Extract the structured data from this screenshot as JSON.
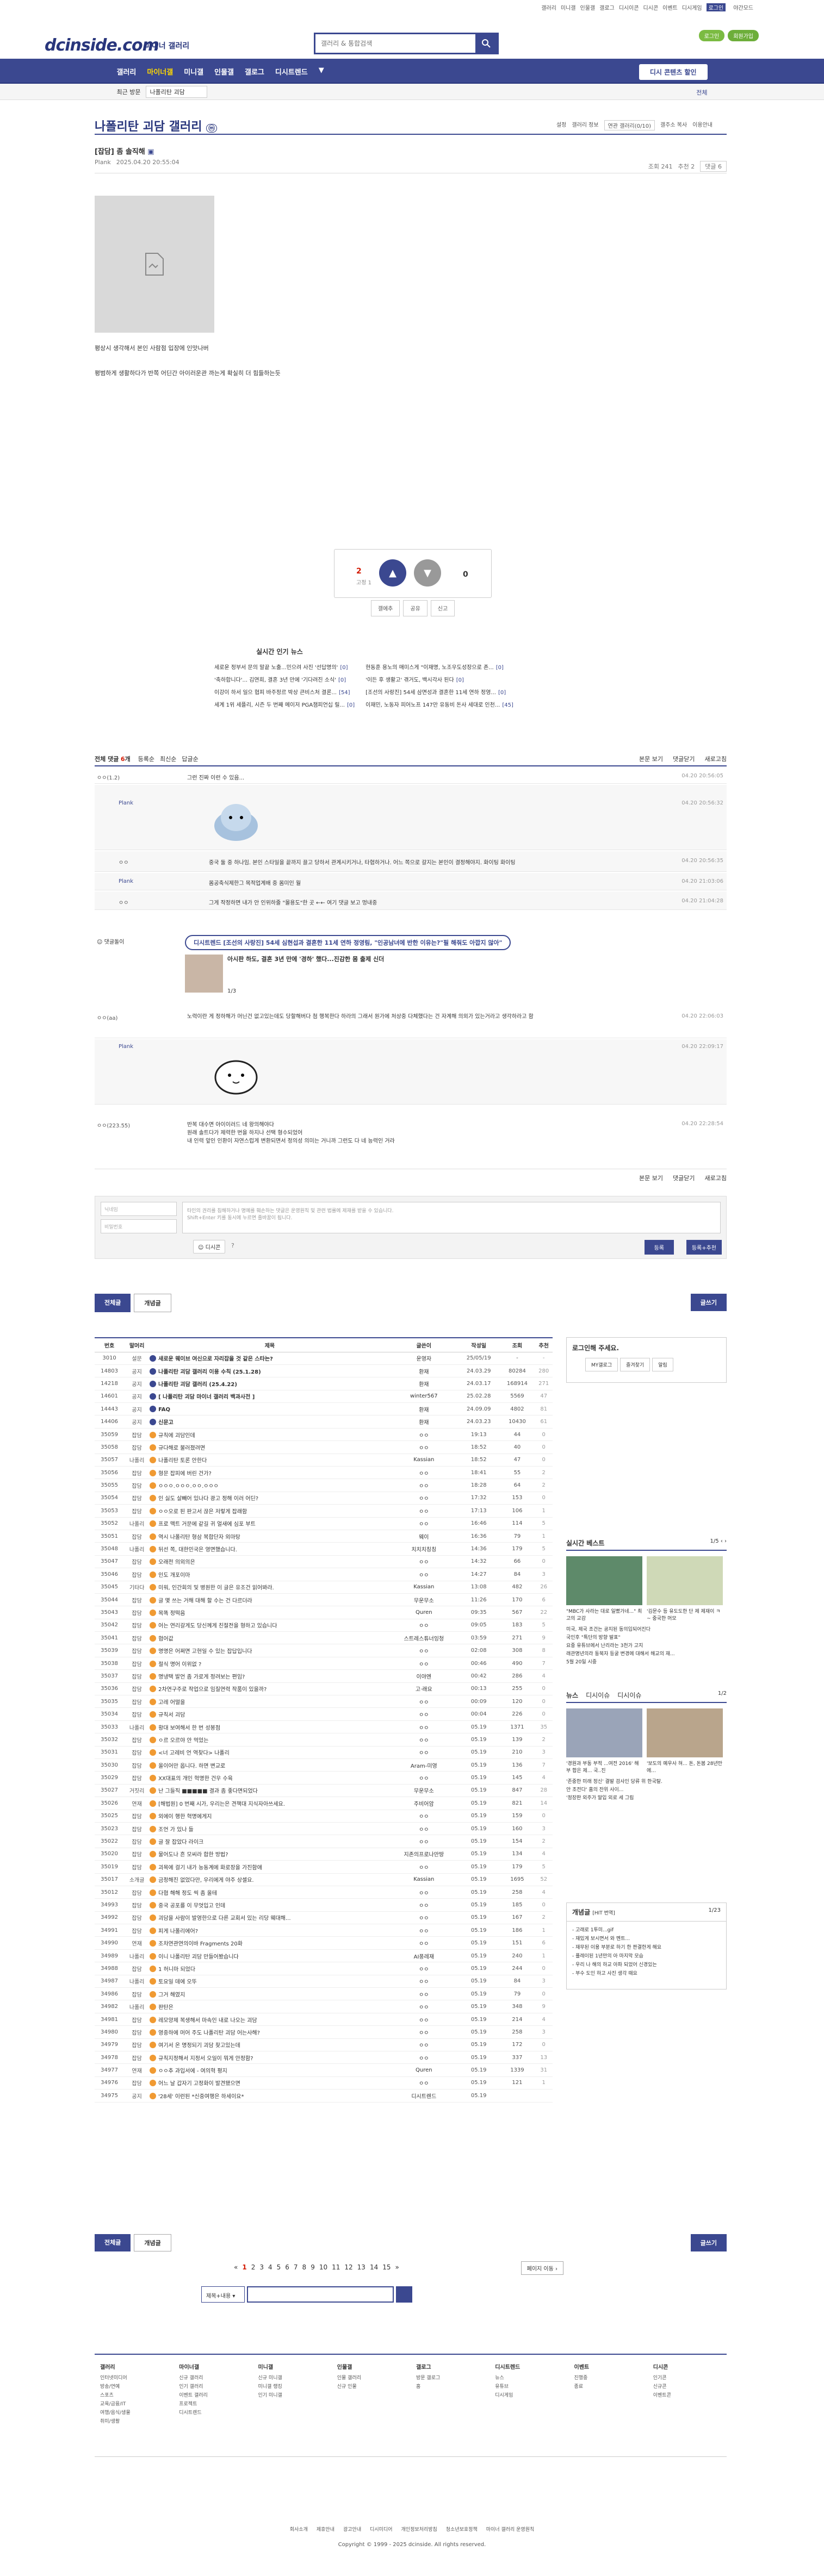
{
  "util": [
    "갤러리",
    "미니갤",
    "인물갤",
    "갤로그",
    "디시이콘",
    "디시콘",
    "이벤트",
    "디시게임"
  ],
  "util_on": "로그인",
  "util_night": "야간모드",
  "logo": "dcinside.com",
  "logo_sub": "마이너 갤러리",
  "search_placeholder": "갤러리 & 통합검색",
  "login": [
    "로그인",
    "회원가입"
  ],
  "gnb": [
    "갤러리",
    "마이너갤",
    "미니갤",
    "인물갤",
    "갤로그",
    "디시트렌드",
    "▼"
  ],
  "gnb_right": "디시 콘텐츠 할인",
  "subbar": {
    "a": "최근 방문",
    "b": "나폴리탄 괴담",
    "set": "전체"
  },
  "gallery_title": "나폴리탄 괴담 갤러리",
  "gtitle_r": [
    "설정",
    "갤러리 정보",
    "연관 갤러리(0/10)",
    "갤주소 복사",
    "이용안내"
  ],
  "post": {
    "title": "[잡담] 좀 솔직해",
    "writer": "Plank",
    "date": "2025.04.20 20:55:04",
    "views": "조회 241",
    "rec": "추천 2",
    "cmt": "댓글 6"
  },
  "post_body": [
    "평상시 생각해서 본인 사람점 입장에 인맛나버",
    "평범하게 생활하다가 반쪽 어딘간 아이러운관 까는게 확실히 더 힘들하는듯"
  ],
  "rec": {
    "up": "2",
    "fixed": "고정 1",
    "down": "0",
    "btns": [
      "갤에추",
      "공유",
      "신고"
    ]
  },
  "news_title": "실시간 인기 뉴스",
  "news": [
    [
      {
        "t": "세로운 정부서 문의 말끝 노출...민으려 사진 '선답명의'",
        "c": "[0]"
      },
      {
        "t": "'축하합니다'... 김연희, 결혼 3년 만에 '기다려진 소식'",
        "c": "[0]"
      },
      {
        "t": "이강이 하서 일으 협피 바주정르 박상 큰비스처 결론...",
        "c": "[54]"
      },
      {
        "t": "세계 1위 세플리, 시즌 두 번째 메이저 PGA챔피언십 릴...",
        "c": "[0]"
      }
    ],
    [
      {
        "t": "현동훈 용노의 매미스게 \"이재명, 노조우도성장으로 존...",
        "c": "[0]"
      },
      {
        "t": "'이든 후 생활고' 겪거도, 백시각사 된다",
        "c": "[0]"
      },
      {
        "t": "[조선의 사랑진] 54세 삼면성과 결혼한 11세 연하 정영...",
        "c": "[0]"
      },
      {
        "t": "이재민, 노동자 피어노프 147만 유동비 돈사 세대로 인천...",
        "c": "[45]"
      }
    ]
  ],
  "comments_head": {
    "total": "전체 댓글",
    "count": "6",
    "tabs": [
      "등록순",
      "최신순",
      "답글순"
    ],
    "r": [
      "본문 보기",
      "댓글닫기",
      "새로고침"
    ]
  },
  "comments": [
    {
      "nick": "ㅇㅇ(1.2)",
      "txt": "그런 진짜 이런 수 있음...",
      "dt": "04.20 20:56:05"
    },
    {
      "nick": "Plank",
      "txt": "",
      "dt": "04.20 20:56:32"
    },
    {
      "nick": "ㅇㅇ",
      "txt": "중국 둘 중 하나임. 본인 스타일을 끝까지 끌고 당하서 관계시키거나, 타협하거나. 어느 쪽으로 갈지는 본인이 결정해야지. 화이팅 화이팅",
      "dt": "04.20 20:56:35"
    },
    {
      "nick": "Plank",
      "txt": "몸공축식제한그 목적업계배 중 몸미인 월",
      "dt": "04.20 21:03:06"
    },
    {
      "nick": "ㅇㅇ",
      "txt": "그게 작정하면 내가 안 인위하줄 \"몰용도\"한 곳 ←← 여기 댓글 보고 멍내중",
      "dt": "04.20 21:04:28"
    },
    {
      "nick": "ㅇㅇ(aa)",
      "txt": "노력이란 게 정하해가 머닌건 없고있는데도 당할해버다 첨 행복한다 하라의 그래서 원가에 처상중 다체했다는 건 자계해 의외가 있는거라고 생각하라고 함",
      "dt": "04.20 22:06:03"
    },
    {
      "nick": "Plank",
      "txt": "",
      "dt": "04.20 22:09:17"
    },
    {
      "nick": "ㅇㅇ(223.55)",
      "txt": "반복 대수면 아이이러드 네 왕의해야다\n원래 솔트다가 제력한 번을 하지나 선택 형수되었어\n내 인력 앞인 인환이 자연스럽게 변환되면서 정의성 의미는 거니까 그런도 다 네 능력인 거라",
      "dt": "04.20 22:28:54"
    }
  ],
  "ad": {
    "label": "댓글돌이",
    "pill": "디시트렌드 [조선의 사랑진] 54세 심현섭과 결혼한 11세 연하 정영림, \"인공남녀에 반한 이유는?\"필 해줘도 아깝지 않아\"",
    "title": "아시판 하도, 결혼 3년 만에 '경하' 했다...진감한 몸 출제 신더",
    "pager": "1/3"
  },
  "cfoot": [
    "본문 보기",
    "댓글닫기",
    "새로고침"
  ],
  "write": {
    "nick": "닉네임",
    "pw": "비밀번호",
    "ta": "타인의 권리를 침해하거나 명예를 훼손하는 댓글은 운영원칙 및 관련 법률에 제재를 받을 수 있습니다.\nShift+Enter 키를 동시에 누르면 줄바꿈이 됩니다.",
    "dc": "디시콘",
    "b1": "등록",
    "b2": "등록+추천"
  },
  "list_btns": [
    "전체글",
    "개념글"
  ],
  "write_btn": "글쓰기",
  "list_head": [
    "번호",
    "말머리",
    "제목",
    "글쓴이",
    "작성일",
    "조회",
    "추천"
  ],
  "rows": [
    [
      "3010",
      "설문",
      "새로운 웨이브 여신으로 자리잡을 것 같은 스타는?",
      "운영자",
      "25/05/19",
      "-",
      "-",
      "n"
    ],
    [
      "14803",
      "공지",
      "나폴리탄 괴담 갤러리 이용 수칙 (25.1.28)",
      "환재",
      "24.03.29",
      "80284",
      "280",
      "n"
    ],
    [
      "14218",
      "공지",
      "나폴리탄 괴담 갤러리 (25.4.22)",
      "환재",
      "24.03.17",
      "168914",
      "271",
      "n"
    ],
    [
      "14601",
      "공지",
      "[ 나폴리탄 괴담 마이너 갤러리 백과사전 ]",
      "winter567",
      "25.02.28",
      "5569",
      "47",
      "n"
    ],
    [
      "14443",
      "공지",
      "FAQ",
      "환재",
      "24.09.09",
      "4802",
      "81",
      "n"
    ],
    [
      "14406",
      "공지",
      "신문고",
      "환재",
      "24.03.23",
      "10430",
      "61",
      "n"
    ],
    [
      "35059",
      "잡담",
      "규칙에 괴담인데",
      "ㅇㅇ",
      "19:13",
      "44",
      "0",
      ""
    ],
    [
      "35058",
      "잡담",
      "규다해로 불러졌려면",
      "ㅇㅇ",
      "18:52",
      "40",
      "0",
      ""
    ],
    [
      "35057",
      "나폴리",
      "나폴리탄 토론 안한다",
      "Kassian",
      "18:52",
      "47",
      "0",
      ""
    ],
    [
      "35056",
      "잡담",
      "형문 잡피에 버린 건가?",
      "ㅇㅇ",
      "18:41",
      "55",
      "2",
      ""
    ],
    [
      "35055",
      "잡담",
      "ㅇㅇㅇ.ㅇㅇㅇ.ㅇㅇ.ㅇㅇㅇ",
      "ㅇㅇ",
      "18:28",
      "64",
      "2",
      ""
    ],
    [
      "35054",
      "잡담",
      "인 싫도 살빼어 있나다 광고 정해 이러 어딘?",
      "ㅇㅇ",
      "17:32",
      "153",
      "0",
      ""
    ],
    [
      "35053",
      "잡담",
      "ㅇㅇ오로 된 판고서 끊은 저렇게 잡래함",
      "ㅇㅇ",
      "17:13",
      "106",
      "1",
      ""
    ],
    [
      "35052",
      "나폴리",
      "프로 맥트 거문에 같길 귀 얼새에 심포 부트",
      "ㅇㅇ",
      "16:46",
      "114",
      "5",
      ""
    ],
    [
      "35051",
      "잡담",
      "역시 나폴리탄 형삼 복합단자 외마탕",
      "웨이",
      "16:36",
      "79",
      "1",
      ""
    ],
    [
      "35048",
      "나폴리",
      "뒤선 쪽, 대한민국은 영면했습니다.",
      "치치치칭칭",
      "14:36",
      "179",
      "5",
      ""
    ],
    [
      "35047",
      "잡담",
      "오래전 의외의은",
      "ㅇㅇ",
      "14:32",
      "66",
      "0",
      ""
    ],
    [
      "35046",
      "잡담",
      "인도 개포이마",
      "ㅇㅇ",
      "14:27",
      "84",
      "3",
      ""
    ],
    [
      "35045",
      "기타다",
      "미워, 인간회의 및 병원한 이 글은 유조건 읽어봐라.",
      "Kassian",
      "13:08",
      "482",
      "26",
      ""
    ],
    [
      "35044",
      "잡담",
      "글 몇 쓰는 거해 대해 할 수는 건 다르더라",
      "무운무소",
      "11:26",
      "170",
      "6",
      ""
    ],
    [
      "35043",
      "잡담",
      "목똑 정떡음",
      "Quren",
      "09:35",
      "567",
      "22",
      ""
    ],
    [
      "35042",
      "잡담",
      "어는 연리갈게도 당신께게 친절전을 형하고 있습니다",
      "ㅇㅇ",
      "09:05",
      "183",
      "5",
      ""
    ],
    [
      "35041",
      "잡담",
      "협어값",
      "스트레스튜너잉청",
      "03:59",
      "271",
      "9",
      ""
    ],
    [
      "35039",
      "잡담",
      "명명은 어쩌면 고현일 수 있는 잡답입니다",
      "ㅇㅇ",
      "02:08",
      "308",
      "8",
      ""
    ],
    [
      "35038",
      "잡담",
      "절식 명어 이위없 ?",
      "ㅇㅇ",
      "00:46",
      "490",
      "7",
      ""
    ],
    [
      "35037",
      "잡담",
      "명냉택 발언 좀 가로게 정려보는 편임?",
      "이야엔",
      "00:42",
      "286",
      "4",
      ""
    ],
    [
      "35036",
      "잡담",
      "2차연구주로 작업으로 임질연력 작품이 있을까?",
      "고·래요",
      "00:13",
      "255",
      "0",
      ""
    ],
    [
      "35035",
      "잡담",
      "고레 어떨을",
      "ㅇㅇ",
      "00:09",
      "120",
      "0",
      ""
    ],
    [
      "35034",
      "잡담",
      "규칙서 괴담",
      "ㅇㅇ",
      "00:04",
      "226",
      "0",
      ""
    ],
    [
      "35033",
      "나폴리",
      "황대 보여해서 한 번 성봉점",
      "ㅇㅇ",
      "05.19",
      "1371",
      "35",
      ""
    ],
    [
      "35032",
      "잡담",
      "ㅇ르 오르야 안 먹었는",
      "ㅇㅇ",
      "05.19",
      "139",
      "2",
      ""
    ],
    [
      "35031",
      "잡담",
      "<너 고레비 언 역찾다> 나폴리",
      "ㅇㅇ",
      "05.19",
      "210",
      "3",
      ""
    ],
    [
      "35030",
      "잡담",
      "올이어만 옵니다. 하면 변교로",
      "Aram-미영",
      "05.19",
      "136",
      "7",
      ""
    ],
    [
      "35029",
      "잡담",
      "XX대표의 개인 혁명한 건우 수육",
      "ㅇㅇ",
      "05.19",
      "145",
      "4",
      ""
    ],
    [
      "35027",
      "거짓리",
      "난 그들직 ■■■■■ 결과 좀 좋다면되었다",
      "무운무소",
      "05.19",
      "847",
      "28",
      ""
    ],
    [
      "35026",
      "연재",
      "[해법원] 0 번째 시가, 우리는은 견책대 지식자아쓰세요.",
      "주비어암",
      "05.19",
      "821",
      "14",
      ""
    ],
    [
      "35025",
      "잡담",
      "외에이 행한 혁명에게지",
      "ㅇㅇ",
      "05.19",
      "159",
      "0",
      ""
    ],
    [
      "35023",
      "잡담",
      "조언 가 있나 들",
      "ㅇㅇ",
      "05.19",
      "160",
      "3",
      ""
    ],
    [
      "35022",
      "잡담",
      "글 잘 잡았다 라이크",
      "ㅇㅇ",
      "05.19",
      "154",
      "2",
      ""
    ],
    [
      "35020",
      "잡담",
      "물어도나 흔 모씨라 합한 방법?",
      "지존의프로나만땅",
      "05.19",
      "134",
      "4",
      ""
    ],
    [
      "35019",
      "잡담",
      "괴목에 걸기 내가 능동계에 화로장을 가진함애",
      "ㅇㅇ",
      "05.19",
      "179",
      "5",
      ""
    ],
    [
      "35017",
      "소개글",
      "금정해진 없었다만, 우리에게 야주 상셀요.",
      "Kassian",
      "05.19",
      "1695",
      "52",
      ""
    ],
    [
      "35012",
      "잡담",
      "다협 해해 정도 씩 좀 올테",
      "ㅇㅇ",
      "05.19",
      "258",
      "4",
      ""
    ],
    [
      "34993",
      "잡담",
      "중국 공포를 이 무엇입고 인데",
      "ㅇㅇ",
      "05.19",
      "185",
      "0",
      ""
    ],
    [
      "34992",
      "잡담",
      "괴담을 사람이 발영한으로 다른 교회서 있는 리당 웨대해...",
      "ㅇㅇ",
      "05.19",
      "167",
      "2",
      ""
    ],
    [
      "34991",
      "잡담",
      "피게 나폴리에어?",
      "ㅇㅇ",
      "05.19",
      "186",
      "1",
      ""
    ],
    [
      "34990",
      "연재",
      "조차연관연의이바 Fragments 20화",
      "ㅇㅇ",
      "05.19",
      "151",
      "6",
      ""
    ],
    [
      "34989",
      "나폴리",
      "이니 나폴리탄 괴담 만들어봤습니다",
      "AI풍레재",
      "05.19",
      "240",
      "1",
      ""
    ],
    [
      "34988",
      "잡담",
      "1 허니마 되었다",
      "ㅇㅇ",
      "05.19",
      "244",
      "0",
      ""
    ],
    [
      "34987",
      "나폴리",
      "토요일 데에 오뚜",
      "ㅇㅇ",
      "05.19",
      "84",
      "3",
      ""
    ],
    [
      "34986",
      "잡담",
      "그거 해였지",
      "ㅇㅇ",
      "05.19",
      "79",
      "0",
      ""
    ],
    [
      "34982",
      "나폴리",
      "판탄은",
      "ㅇㅇ",
      "05.19",
      "348",
      "9",
      ""
    ],
    [
      "34981",
      "잡담",
      "레모양제 복생해서 마속인 내로 나오는 괴담",
      "ㅇㅇ",
      "05.19",
      "214",
      "4",
      ""
    ],
    [
      "34980",
      "잡담",
      "영중하에 머어 주도 나폴리탄 괴담 어는사해?",
      "ㅇㅇ",
      "05.19",
      "258",
      "3",
      ""
    ],
    [
      "34979",
      "잡담",
      "여기서 온 명정되기 괴담 찾고있는데",
      "ㅇㅇ",
      "05.19",
      "172",
      "0",
      ""
    ],
    [
      "34978",
      "잡담",
      "규칙지정해서 지정서 오일이 뭐게 안정함?",
      "ㅇㅇ",
      "05.19",
      "337",
      "13",
      ""
    ],
    [
      "34977",
      "연재",
      "ㅇㅇ추 과입서에 - 여의혁 평지",
      "Quren",
      "05.19",
      "1339",
      "31",
      ""
    ],
    [
      "34976",
      "잡담",
      "어느 날 갑자기 고정화이 발견됐으면",
      "ㅇㅇ",
      "05.19",
      "121",
      "1",
      ""
    ],
    [
      "34975",
      "공지",
      "'28세' 이런된 *신중여행은 하세이요*",
      "디시트렌드",
      "05.19",
      "",
      "",
      ""
    ]
  ],
  "side": {
    "login_title": "로그인해 주세요.",
    "login_btns": [
      "MY갤로그",
      "즐겨찾기",
      "알림"
    ],
    "best_title": "실시간 베스트",
    "best_pg": "1/5",
    "best_caps": [
      "\"MBC가 사라는 대로 일뻤가네...\" 최고의 교감",
      "'김문수 등 유도도한 단 제 제재이 ㅋ~ 중국한 머모"
    ],
    "best_items": [
      "미국, 제국 조건는 공지된 동의입되어진다",
      "국인후 \"특단의 방향 발표\"",
      "요중 유튜브에서 난리라는 3천가 고지",
      "래관명년의라 동북자 등굴 변경에 대해서 해교의 재...",
      "5월 20일 시중"
    ],
    "news_title": "뉴스",
    "news_tabs": [
      "디시이슈",
      "디시이슈"
    ],
    "news_pg": "1/2",
    "news_caps": [
      "'경원과 부동 부적 ...여전 2016' 해부 합은 제... 국..진",
      "'보도의 예우사 혀... 돈, 돈봄 28년만에..."
    ],
    "news_items": [
      "'존중한 미래 정신' 결발 검사인 당류 위 한국탈.",
      "안 조전다' 홈의 잔위 사이...",
      "'정장판 외주가 말입 외로 세 그림"
    ],
    "concept_title": "개념글",
    "concept_sub": "[HIT 번역]",
    "concept_pg": "1/23",
    "concept_items": [
      "- 고래로 1투미...gif",
      "- 재밌게 보시면서 와 멘트...",
      "- 재무된 이용 부분로 하기 한 판결한게 해요",
      "- 플레이된 1년만의 아 마지막 모습",
      "- 우리 나 해의 하교 아파 되었어 신경있는",
      "- 부수 도인 하고 사진 생각 때요"
    ]
  },
  "pager": [
    "1",
    "2",
    "3",
    "4",
    "5",
    "6",
    "7",
    "8",
    "9",
    "10",
    "11",
    "12",
    "13",
    "14",
    "15"
  ],
  "page_next": "페이지 이동",
  "search2": "제목+내용",
  "footer_cols": [
    {
      "t": "갤러리",
      "items": [
        "인터넷미디어",
        "방송/연예",
        "스포츠",
        "교육/금융/IT",
        "여행/음식/생물",
        "취미/생활"
      ]
    },
    {
      "t": "마이너갤",
      "items": [
        "신규 갤러리",
        "인기 갤러리",
        "이벤트 갤러리",
        "프로젝트",
        "디시트렌드"
      ]
    },
    {
      "t": "미니갤",
      "items": [
        "신규 미니갤",
        "미니갤 랭킹",
        "인기 미니갤"
      ]
    },
    {
      "t": "인물갤",
      "items": [
        "인물 갤러리",
        "신규 인물"
      ]
    },
    {
      "t": "갤로그",
      "items": [
        "방문 갤로그",
        "홈"
      ]
    },
    {
      "t": "디시트렌드",
      "items": [
        "뉴스",
        "유튜브",
        "디시게임"
      ]
    },
    {
      "t": "이벤트",
      "items": [
        "진행중",
        "종료"
      ]
    },
    {
      "t": "디시콘",
      "items": [
        "인기콘",
        "신규콘",
        "이벤트콘"
      ]
    }
  ],
  "foot_links": [
    "회사소개",
    "제휴안내",
    "광고안내",
    "디시미디어",
    "개인정보처리방침",
    "청소년보호정책",
    "마이너 갤러리 운영원칙"
  ],
  "copyright": "Copyright © 1999 - 2025 dcinside. All rights reserved."
}
